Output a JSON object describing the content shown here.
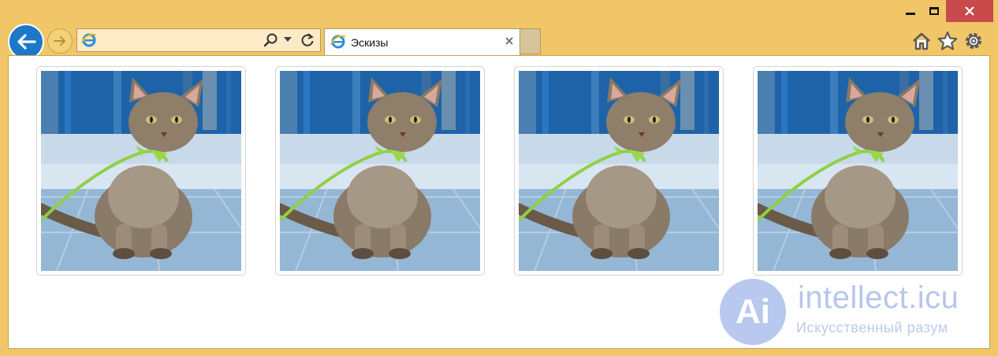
{
  "window": {
    "caption_buttons": [
      "minimize",
      "maximize",
      "close"
    ],
    "close_color": "#c84a4a"
  },
  "nav": {
    "back_icon": "back-arrow-icon",
    "forward_icon": "forward-arrow-icon"
  },
  "address": {
    "value": "",
    "placeholder": "",
    "icons": [
      "ie-logo-icon",
      "search-icon",
      "dropdown-arrow-icon",
      "refresh-icon"
    ]
  },
  "tab": {
    "label": "Эскизы"
  },
  "toolbar": {
    "icons": [
      "home-icon",
      "star-icon",
      "gear-icon"
    ]
  },
  "gallery": {
    "thumbnails": [
      {
        "subject": "kitten"
      },
      {
        "subject": "kitten"
      },
      {
        "subject": "kitten"
      },
      {
        "subject": "kitten"
      }
    ]
  },
  "watermark": {
    "logo_text": "Ai",
    "title": "intellect.icu",
    "subtitle": "Искусственный разум"
  },
  "colors": {
    "frame": "#f0c668",
    "back_button": "#1c78c8",
    "address_bg": "#fcebc6"
  }
}
